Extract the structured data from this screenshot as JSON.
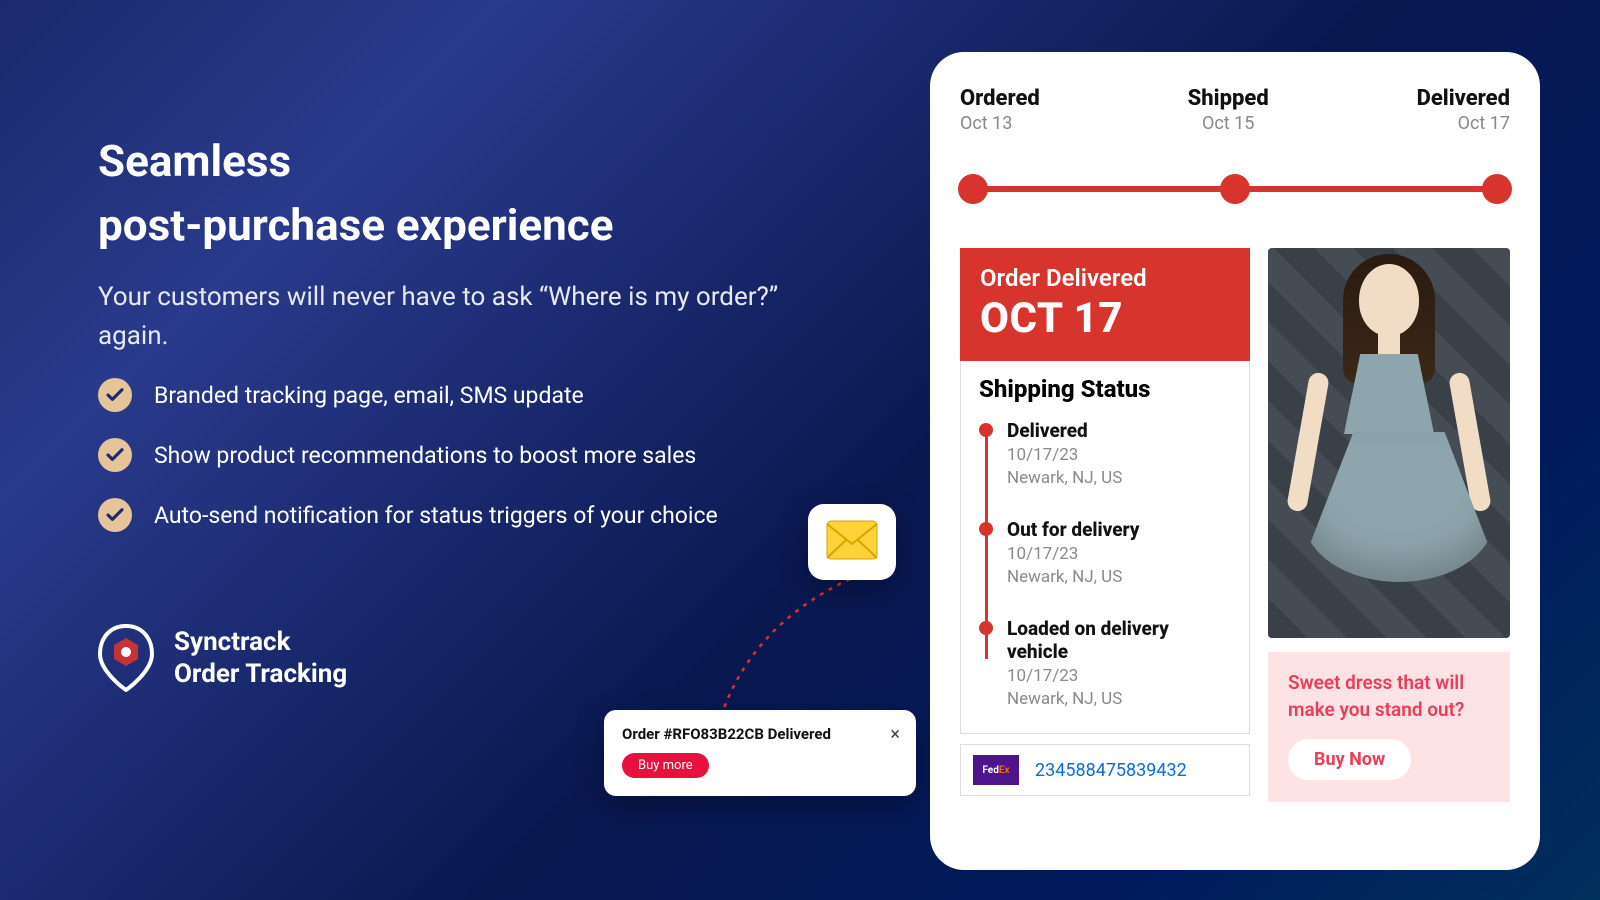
{
  "headline": {
    "line1": "Seamless",
    "line2": "post-purchase experience"
  },
  "subhead": "Your customers will never have to ask “Where is my order?” again.",
  "features": [
    "Branded tracking page, email, SMS update",
    "Show product recommendations to boost more sales",
    "Auto-send notification for status triggers of your choice"
  ],
  "brand": {
    "line1": "Synctrack",
    "line2": "Order Tracking"
  },
  "email_icon": "envelope-icon",
  "toast": {
    "title": "Order #RFO83B22CB Delivered",
    "button": "Buy more",
    "close": "×"
  },
  "tracker": {
    "timeline": [
      {
        "title": "Ordered",
        "date": "Oct 13"
      },
      {
        "title": "Shipped",
        "date": "Oct 15"
      },
      {
        "title": "Delivered",
        "date": "Oct 17"
      }
    ],
    "banner": {
      "title": "Order Delivered",
      "date": "OCT 17"
    },
    "status_heading": "Shipping Status",
    "events": [
      {
        "title": "Delivered",
        "date": "10/17/23",
        "location": "Newark, NJ, US"
      },
      {
        "title": "Out for delivery",
        "date": "10/17/23",
        "location": "Newark, NJ, US"
      },
      {
        "title": "Loaded on delivery vehicle",
        "date": "10/17/23",
        "location": "Newark, NJ, US"
      }
    ],
    "carrier": {
      "name": "FedEx",
      "logo_fed": "Fed",
      "logo_ex": "Ex",
      "tracking_number": "234588475839432"
    },
    "promo": {
      "text": "Sweet dress that will make you stand out?",
      "button": "Buy Now"
    }
  },
  "colors": {
    "accent_red": "#d6342d",
    "accent_pink": "#e83e5a",
    "check_bg": "#e6c49a"
  }
}
